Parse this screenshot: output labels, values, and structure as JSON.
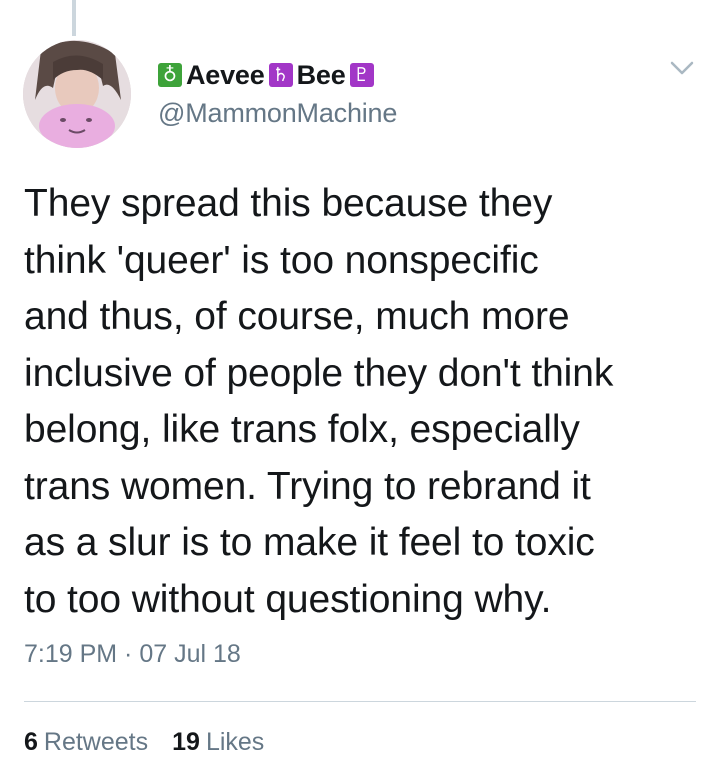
{
  "tweet": {
    "author": {
      "name_prefix_glyph": "♁",
      "name_first": "Aevee",
      "name_middle_glyph": "♄",
      "name_last": "Bee",
      "name_suffix_glyph": "♇",
      "handle": "@MammonMachine"
    },
    "text_lines": [
      "They spread this because they",
      "think 'queer' is too nonspecific",
      "and thus, of course, much more",
      "inclusive of people they don't think",
      "belong, like trans folx, especially",
      "trans women. Trying to rebrand it",
      "as a slur is to make it feel to toxic",
      "to too without questioning why."
    ],
    "timestamp": "7:19 PM · 07 Jul 18",
    "retweets_count": "6",
    "retweets_label": "Retweets",
    "likes_count": "19",
    "likes_label": "Likes"
  },
  "icons": {
    "caret": "chevron-down-icon",
    "avatar": "avatar"
  },
  "colors": {
    "text": "#14171a",
    "secondary": "#657786",
    "divider": "#ccd6dd",
    "badge_green": "#3ea33a",
    "badge_purple": "#a236c7"
  }
}
